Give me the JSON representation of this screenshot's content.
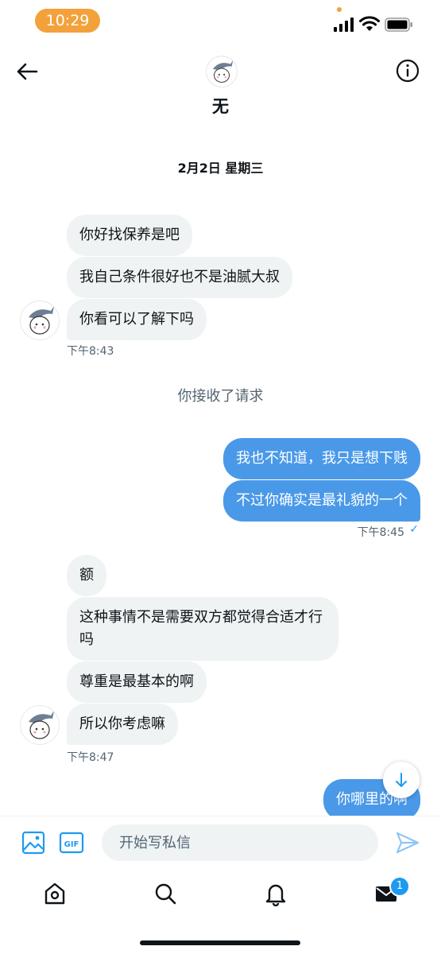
{
  "status_bar": {
    "time": "10:29"
  },
  "header": {
    "name": "无"
  },
  "conversation": {
    "date_separator": "2月2日 星期三",
    "system_message": "你接收了请求",
    "group1": {
      "messages": [
        "你好找保养是吧",
        "我自己条件很好也不是油腻大叔",
        "你看可以了解下吗"
      ],
      "time": "下午8:43"
    },
    "group2": {
      "messages": [
        "我也不知道，我只是想下贱",
        "不过你确实是最礼貌的一个"
      ],
      "time": "下午8:45",
      "read_mark": "✓"
    },
    "group3": {
      "messages": [
        "额",
        "这种事情不是需要双方都觉得合适才行吗",
        "尊重是最基本的啊",
        "所以你考虑嘛"
      ],
      "time": "下午8:47"
    },
    "group4": {
      "messages": [
        "你哪里的啊"
      ]
    }
  },
  "compose": {
    "placeholder": "开始写私信",
    "gif_label": "GIF"
  },
  "tabbar": {
    "messages_badge": "1"
  },
  "colors": {
    "accent": "#1d9bf0",
    "outgoing_bubble": "#4a99e9",
    "incoming_bubble": "#eff3f4",
    "time_pill": "#f3a23b"
  }
}
